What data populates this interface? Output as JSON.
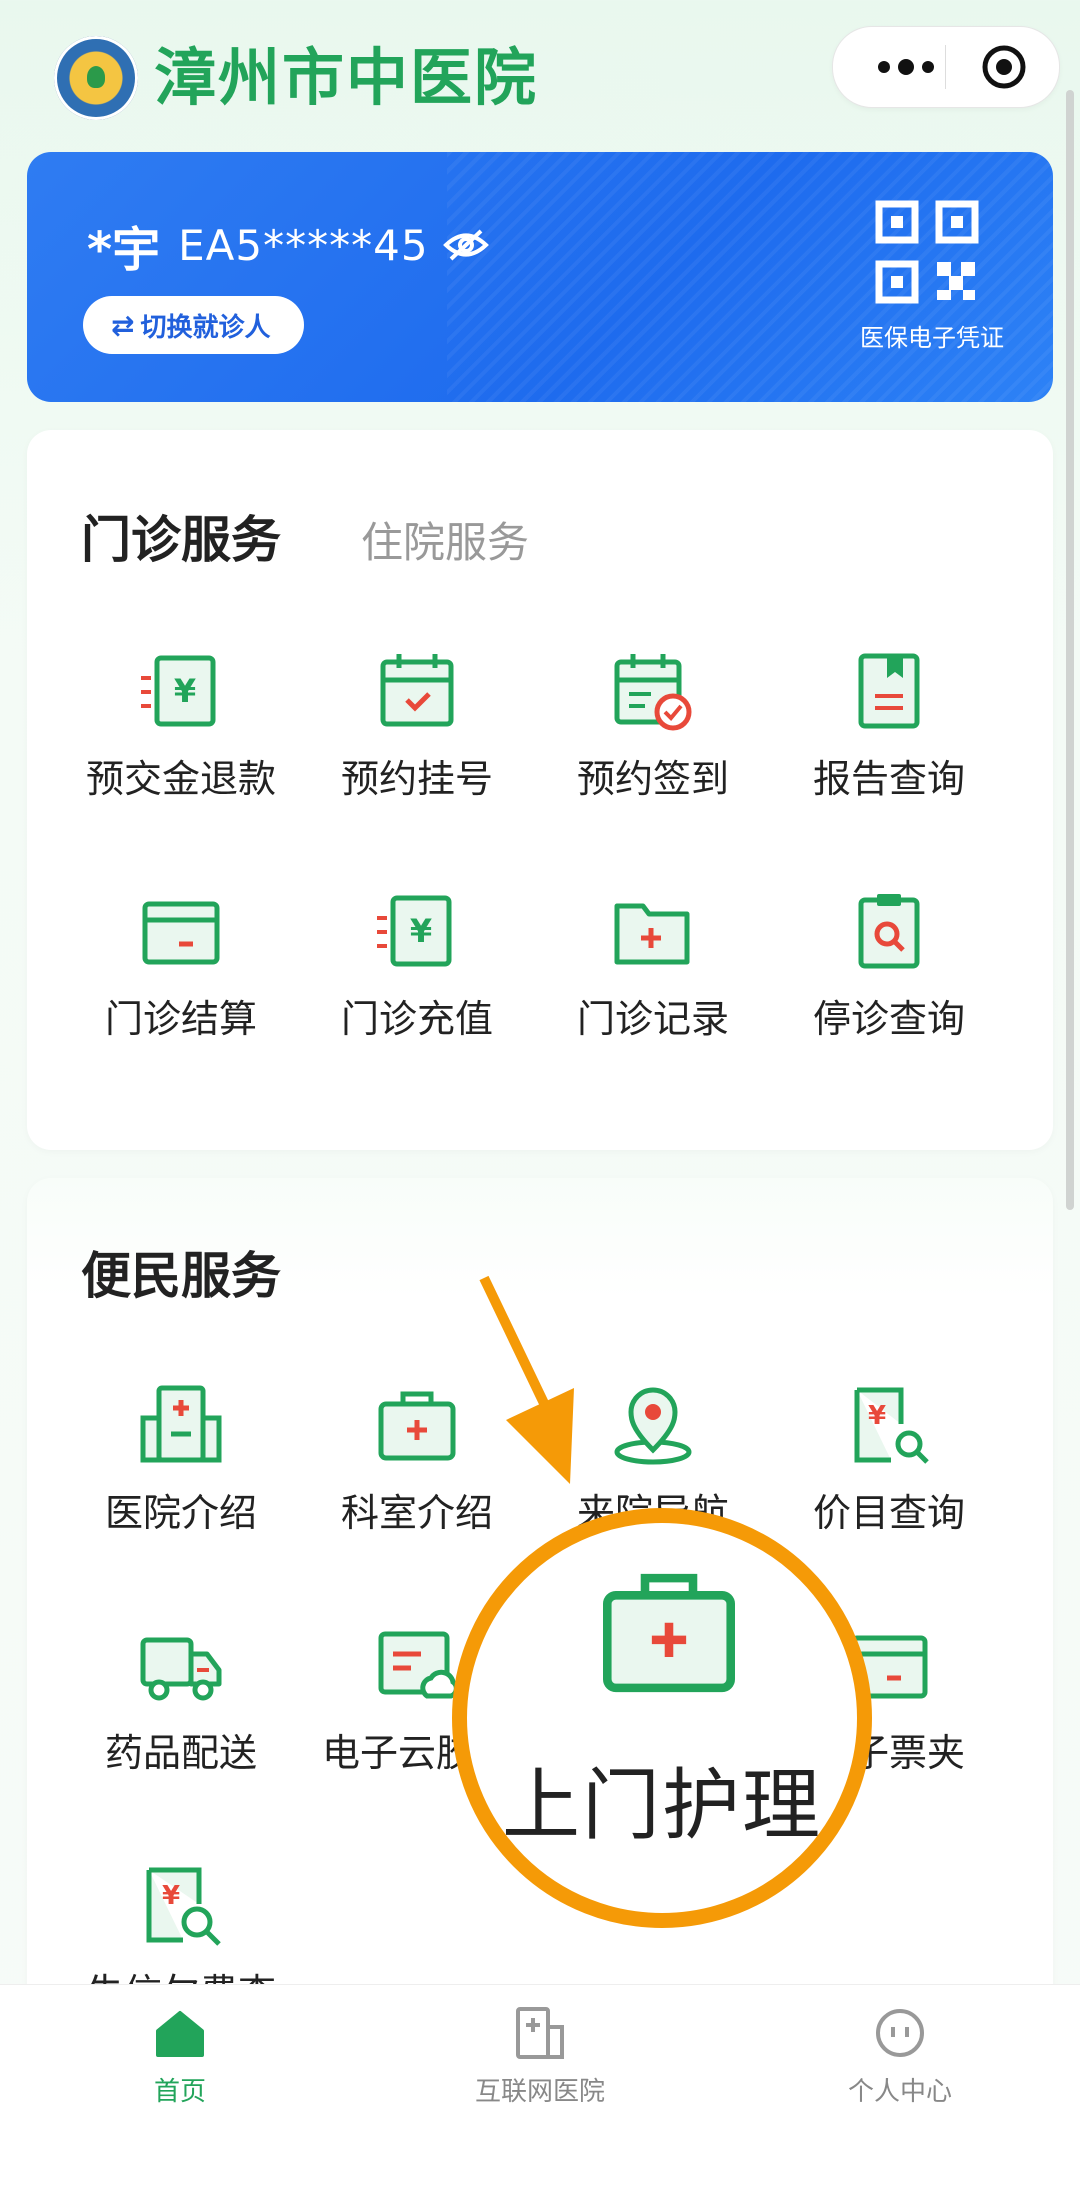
{
  "header": {
    "title": "漳州市中医院",
    "more_icon": "more-dots-icon",
    "close_icon": "target-icon"
  },
  "card": {
    "patient_name": "*宇",
    "card_number": "EA5*****45",
    "switch_label": "切换就诊人",
    "qr_label": "医保电子凭证",
    "color": "#1e6bee"
  },
  "outpatient": {
    "tabs": [
      {
        "label": "门诊服务",
        "active": true
      },
      {
        "label": "住院服务",
        "active": false
      }
    ],
    "items": [
      {
        "label": "预交金退款",
        "icon": "yen-refund-icon"
      },
      {
        "label": "预约挂号",
        "icon": "calendar-icon"
      },
      {
        "label": "预约签到",
        "icon": "calendar-check-icon"
      },
      {
        "label": "报告查询",
        "icon": "report-icon"
      },
      {
        "label": "门诊结算",
        "icon": "card-minus-icon"
      },
      {
        "label": "门诊充值",
        "icon": "yen-topup-icon"
      },
      {
        "label": "门诊记录",
        "icon": "folder-plus-icon"
      },
      {
        "label": "停诊查询",
        "icon": "clipboard-search-icon"
      }
    ]
  },
  "convenience": {
    "title": "便民服务",
    "items": [
      {
        "label": "医院介绍",
        "icon": "hospital-icon"
      },
      {
        "label": "科室介绍",
        "icon": "medical-kit-icon"
      },
      {
        "label": "来院导航",
        "icon": "location-pin-icon"
      },
      {
        "label": "价目查询",
        "icon": "price-search-icon"
      },
      {
        "label": "药品配送",
        "icon": "truck-icon"
      },
      {
        "label": "电子云胶片",
        "icon": "cloud-film-icon"
      },
      {
        "label": "电子票夹",
        "icon": "ticket-icon"
      },
      {
        "label": "失信欠费查",
        "icon": "yen-search-icon"
      }
    ]
  },
  "overlay": {
    "label": "上门护理",
    "icon": "medical-kit-icon",
    "accent": "#f59a07"
  },
  "tabbar": [
    {
      "label": "首页",
      "active": true
    },
    {
      "label": "互联网医院",
      "active": false
    },
    {
      "label": "个人中心",
      "active": false
    }
  ],
  "colors": {
    "brand_green": "#22a45a",
    "icon_red": "#e8493a"
  }
}
